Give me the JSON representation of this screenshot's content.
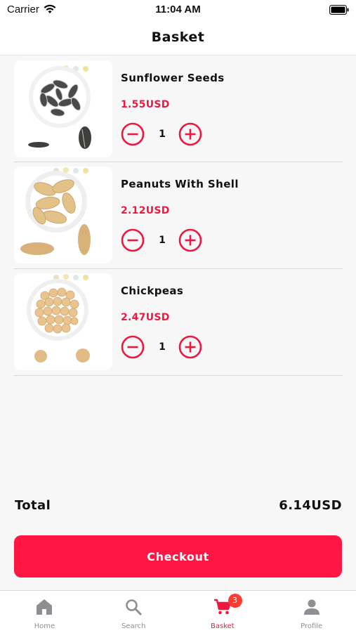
{
  "status": {
    "carrier": "Carrier",
    "time": "11:04 AM"
  },
  "header": {
    "title": "Basket"
  },
  "basket": {
    "items": [
      {
        "name": "Sunflower Seeds",
        "price": "1.55USD",
        "quantity": "1"
      },
      {
        "name": "Peanuts With Shell",
        "price": "2.12USD",
        "quantity": "1"
      },
      {
        "name": "Chickpeas",
        "price": "2.47USD",
        "quantity": "1"
      }
    ]
  },
  "summary": {
    "total_label": "Total",
    "total_value": "6.14USD"
  },
  "checkout": {
    "label": "Checkout"
  },
  "tabbar": {
    "tabs": [
      {
        "label": "Home",
        "icon": "home-icon"
      },
      {
        "label": "Search",
        "icon": "search-icon"
      },
      {
        "label": "Basket",
        "icon": "cart-icon",
        "badge": "3"
      },
      {
        "label": "Profile",
        "icon": "person-icon"
      }
    ],
    "active_tab": "Basket"
  },
  "colors": {
    "accent": "#ff1744",
    "price": "#f0173f",
    "background": "#f7f7f7",
    "inactive_tab": "#8e8e93"
  }
}
